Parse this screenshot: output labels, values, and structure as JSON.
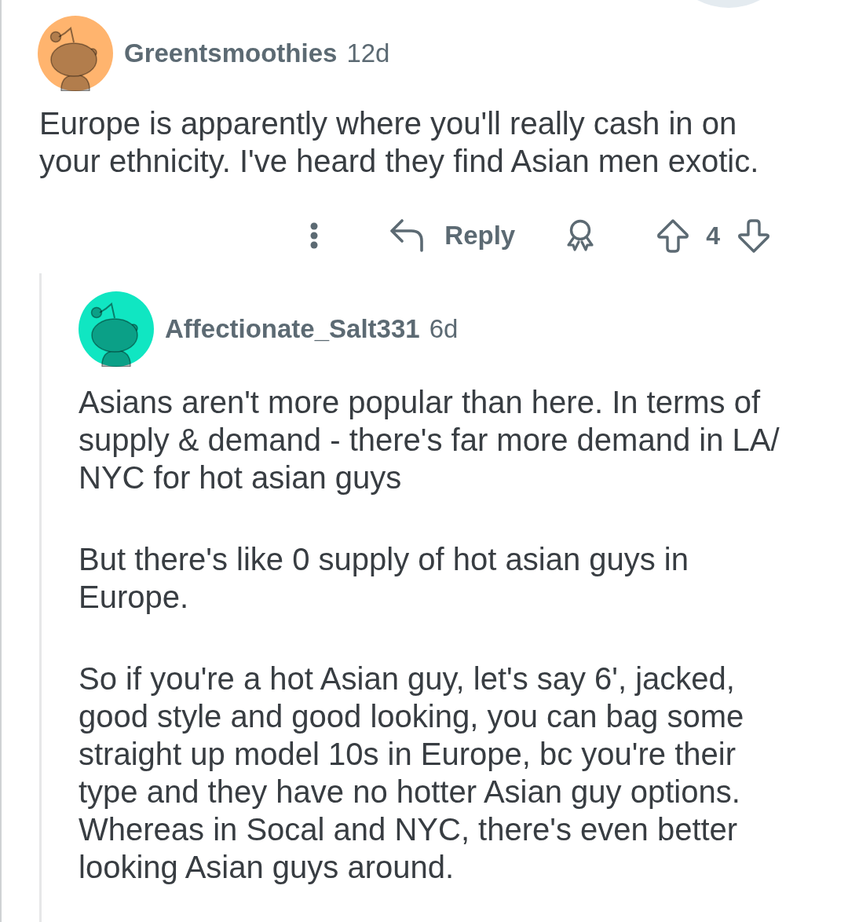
{
  "comments": [
    {
      "author": "Greentsmoothies",
      "age": "12d",
      "color": "#ffb46e",
      "paragraphs": [
        "Europe is apparently where you'll really cash in on your ethnicity. I've heard they find Asian men exotic."
      ],
      "actions": {
        "reply": "Reply",
        "score": "4"
      },
      "children": [
        {
          "author": "Affectionate_Salt331",
          "age": "6d",
          "color": "#10e6c2",
          "paragraphs": [
            "Asians aren't more popular than here. In terms of supply & demand - there's far more demand in LA/NYC for hot asian guys",
            "But there's like 0 supply of hot asian guys in Europe.",
            "So if you're a hot Asian guy, let's say 6', jacked, good style and good looking, you can bag some straight up model 10s in Europe, bc you're their type and they have no hotter Asian guy options. Whereas in Socal and NYC, there's even better looking Asian guys around."
          ]
        }
      ]
    }
  ]
}
